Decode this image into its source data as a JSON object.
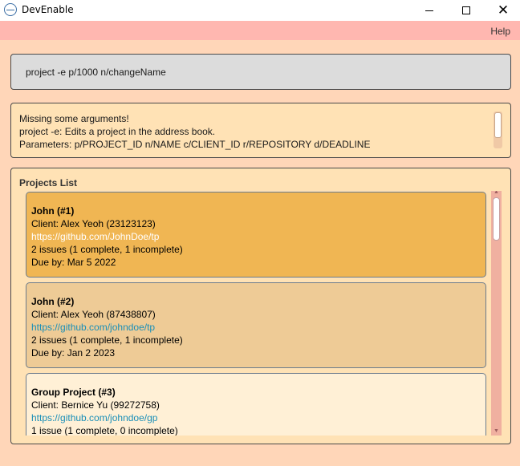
{
  "window": {
    "title": "DevEnable",
    "icon": "app-icon",
    "controls": [
      "minimize-icon",
      "maximize-icon",
      "close-icon"
    ]
  },
  "menu": {
    "help_label": "Help"
  },
  "command": {
    "value": "project -e p/1000 n/changeName"
  },
  "result": {
    "lines": [
      "Missing some arguments!",
      "project -e: Edits a project in the address book.",
      "Parameters: p/PROJECT_ID n/NAME c/CLIENT_ID r/REPOSITORY d/DEADLINE"
    ]
  },
  "projects": {
    "title": "Projects List",
    "items": [
      {
        "name": "John (#1)",
        "client": "Client: Alex Yeoh (23123123)",
        "repo": "https://github.com/JohnDoe/tp",
        "issues": "2 issues (1 complete, 1 incomplete)",
        "due": "Due by: Mar 5 2022",
        "color": "#f0b653",
        "selected": true
      },
      {
        "name": "John (#2)",
        "client": "Client: Alex Yeoh (87438807)",
        "repo": "https://github.com/johndoe/tp",
        "issues": "2 issues (1 complete, 1 incomplete)",
        "due": "Due by: Jan 2 2023",
        "color": "#eecb96",
        "selected": false
      },
      {
        "name": "Group Project (#3)",
        "client": "Client: Bernice Yu (99272758)",
        "repo": "https://github.com/johndoe/gp",
        "issues": "1 issue (1 complete, 0 incomplete)",
        "due": "",
        "color": "#fff0d6",
        "selected": false
      }
    ]
  },
  "colors": {
    "menubar": "#ffb7b0",
    "background": "#ffd6b8",
    "panel": "#ffe2b5",
    "link": "#1a8fb8"
  }
}
